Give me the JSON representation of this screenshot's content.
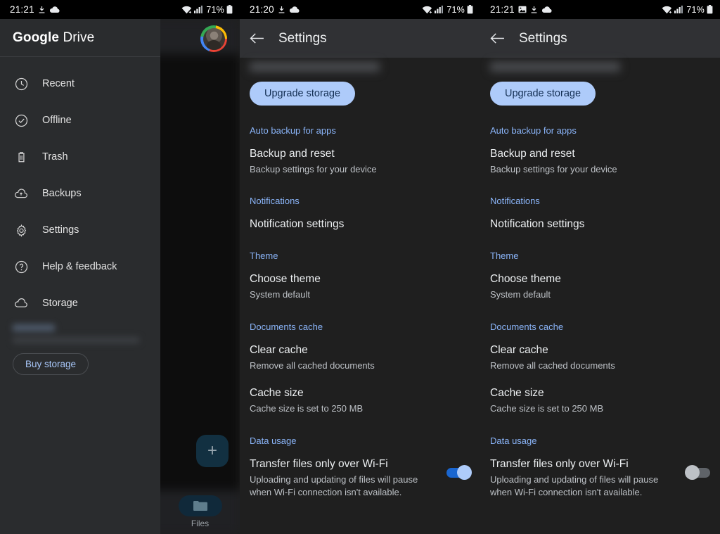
{
  "panels": [
    {
      "status": {
        "time": "21:21",
        "icons": [
          "download-icon",
          "cloud-icon"
        ],
        "wifi": "wifi-icon",
        "signal": "signal-icon",
        "battery_pct": "71%"
      },
      "drawer": {
        "logo_bold": "Google",
        "logo_thin": "Drive",
        "items": [
          {
            "label": "Recent",
            "icon": "clock-icon"
          },
          {
            "label": "Offline",
            "icon": "offline-check-icon"
          },
          {
            "label": "Trash",
            "icon": "trash-icon"
          },
          {
            "label": "Backups",
            "icon": "cloud-upload-icon"
          },
          {
            "label": "Settings",
            "icon": "gear-icon"
          },
          {
            "label": "Help & feedback",
            "icon": "help-circle-icon"
          },
          {
            "label": "Storage",
            "icon": "cloud-icon"
          }
        ],
        "buy_storage_label": "Buy storage"
      },
      "fab_label": "+",
      "bottom_nav_label": "Files"
    },
    {
      "status": {
        "time": "21:20",
        "icons": [
          "download-icon",
          "cloud-icon"
        ],
        "battery_pct": "71%"
      },
      "appbar": {
        "back_icon": "arrow-back-icon",
        "title": "Settings"
      },
      "upgrade_label": "Upgrade storage",
      "sections": [
        {
          "label": "Auto backup for apps",
          "rows": [
            {
              "title": "Backup and reset",
              "sub": "Backup settings for your device"
            }
          ]
        },
        {
          "label": "Notifications",
          "rows": [
            {
              "title": "Notification settings",
              "sub": ""
            }
          ]
        },
        {
          "label": "Theme",
          "rows": [
            {
              "title": "Choose theme",
              "sub": "System default"
            }
          ]
        },
        {
          "label": "Documents cache",
          "rows": [
            {
              "title": "Clear cache",
              "sub": "Remove all cached documents"
            },
            {
              "title": "Cache size",
              "sub": "Cache size is set to 250 MB"
            }
          ]
        },
        {
          "label": "Data usage",
          "rows": [
            {
              "title": "Transfer files only over Wi-Fi",
              "sub": "Uploading and updating of files will pause when Wi-Fi connection isn't available.",
              "toggle": "on"
            }
          ]
        }
      ]
    },
    {
      "status": {
        "time": "21:21",
        "icons": [
          "image-icon",
          "download-icon",
          "cloud-icon"
        ],
        "battery_pct": "71%"
      },
      "appbar": {
        "back_icon": "arrow-back-icon",
        "title": "Settings"
      },
      "upgrade_label": "Upgrade storage",
      "sections": [
        {
          "label": "Auto backup for apps",
          "rows": [
            {
              "title": "Backup and reset",
              "sub": "Backup settings for your device"
            }
          ]
        },
        {
          "label": "Notifications",
          "rows": [
            {
              "title": "Notification settings",
              "sub": ""
            }
          ]
        },
        {
          "label": "Theme",
          "rows": [
            {
              "title": "Choose theme",
              "sub": "System default"
            }
          ]
        },
        {
          "label": "Documents cache",
          "rows": [
            {
              "title": "Clear cache",
              "sub": "Remove all cached documents"
            },
            {
              "title": "Cache size",
              "sub": "Cache size is set to 250 MB"
            }
          ]
        },
        {
          "label": "Data usage",
          "rows": [
            {
              "title": "Transfer files only over Wi-Fi",
              "sub": "Uploading and updating of files will pause when Wi-Fi connection isn't available.",
              "toggle": "off"
            }
          ]
        }
      ]
    }
  ],
  "colors": {
    "accent_blue": "#8ab4f8",
    "button_fill": "#aecbfa",
    "toggle_on_track": "#1a66d0",
    "background": "#1f1f1f",
    "appbar": "#303134",
    "drawer": "#2a2c2e"
  }
}
